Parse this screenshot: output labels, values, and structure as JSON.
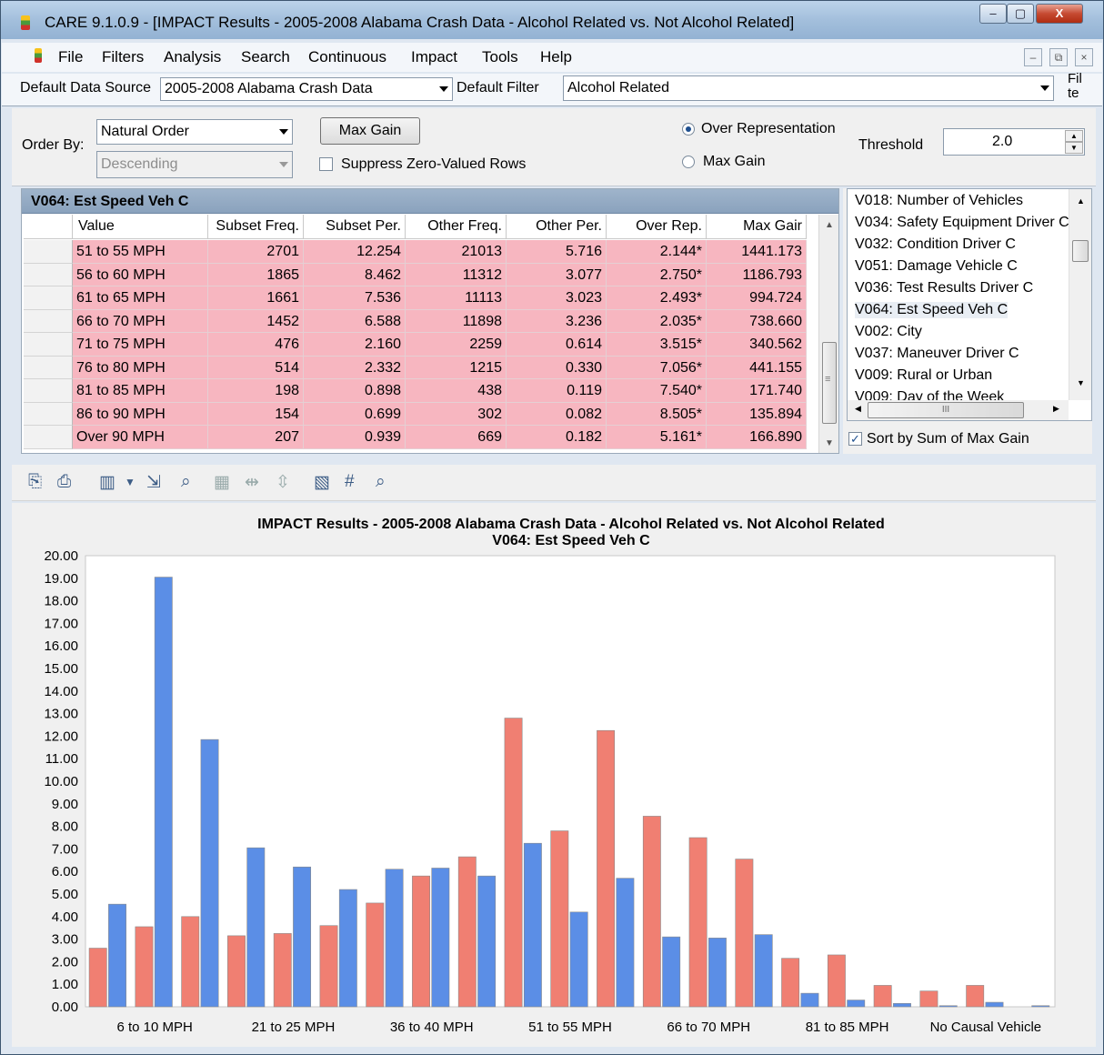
{
  "window": {
    "title": "CARE 9.1.0.9 - [IMPACT Results - 2005-2008 Alabama Crash Data - Alcohol Related vs. Not Alcohol Related]",
    "controls": {
      "minimize": "–",
      "maximize": "▢",
      "close": "X"
    }
  },
  "menu": {
    "items": [
      "File",
      "Filters",
      "Analysis",
      "Search",
      "Continuous",
      "Impact",
      "Tools",
      "Help"
    ],
    "mdi": {
      "minimize": "–",
      "restore": "⧉",
      "close": "×"
    }
  },
  "source_bar": {
    "data_source_label": "Default Data Source",
    "data_source_value": "2005-2008 Alabama Crash Data",
    "filter_label": "Default Filter",
    "filter_value": "Alcohol Related",
    "fil_button": "Fil te"
  },
  "options": {
    "order_by_label": "Order By:",
    "order_value": "Natural Order",
    "direction_value": "Descending",
    "max_gain_button": "Max Gain",
    "suppress_label": "Suppress Zero-Valued Rows",
    "suppress_checked": false,
    "radio_over_rep": "Over Representation",
    "radio_max_gain": "Max Gain",
    "selected_radio": "Over Representation",
    "threshold_label": "Threshold",
    "threshold_value": "2.0"
  },
  "grid": {
    "title": "V064: Est Speed Veh C",
    "columns": [
      "Value",
      "Subset Freq.",
      "Subset Per.",
      "Other Freq.",
      "Other Per.",
      "Over Rep.",
      "Max Gair"
    ],
    "rows": [
      [
        "51 to 55 MPH",
        "2701",
        "12.254",
        "21013",
        "5.716",
        "2.144*",
        "1441.173"
      ],
      [
        "56 to 60 MPH",
        "1865",
        "8.462",
        "11312",
        "3.077",
        "2.750*",
        "1186.793"
      ],
      [
        "61 to 65 MPH",
        "1661",
        "7.536",
        "11113",
        "3.023",
        "2.493*",
        "994.724"
      ],
      [
        "66 to 70 MPH",
        "1452",
        "6.588",
        "11898",
        "3.236",
        "2.035*",
        "738.660"
      ],
      [
        "71 to 75 MPH",
        "476",
        "2.160",
        "2259",
        "0.614",
        "3.515*",
        "340.562"
      ],
      [
        "76 to 80 MPH",
        "514",
        "2.332",
        "1215",
        "0.330",
        "7.056*",
        "441.155"
      ],
      [
        "81 to 85 MPH",
        "198",
        "0.898",
        "438",
        "0.119",
        "7.540*",
        "171.740"
      ],
      [
        "86 to 90 MPH",
        "154",
        "0.699",
        "302",
        "0.082",
        "8.505*",
        "135.894"
      ],
      [
        "Over 90 MPH",
        "207",
        "0.939",
        "669",
        "0.182",
        "5.161*",
        "166.890"
      ]
    ]
  },
  "variable_list": {
    "items": [
      "V018: Number of Vehicles",
      "V034: Safety Equipment Driver C",
      "V032: Condition Driver C",
      "V051: Damage Vehicle C",
      "V036: Test Results Driver C",
      "V064: Est Speed Veh C",
      "V002: City",
      "V037: Maneuver Driver C",
      "V009: Rural or Urban",
      "V009: Day of the Week"
    ],
    "selected_index": 5,
    "hscroll_grip": "III",
    "sort_label": "Sort by Sum of Max Gain",
    "sort_checked": true
  },
  "toolbar": {
    "icons": [
      "copy-icon",
      "print-icon",
      "chart-type-icon",
      "dropdown-arrow-icon",
      "export-icon",
      "zoom-in-icon",
      "grid-icon",
      "chevron-left-right-icon",
      "chevron-up-down-icon",
      "chart-options-icon",
      "data-labels-icon",
      "zoom-icon"
    ]
  },
  "chart_data": {
    "type": "bar",
    "title": "IMPACT Results - 2005-2008 Alabama Crash Data - Alcohol Related vs. Not Alcohol Related",
    "subtitle": "V064: Est Speed Veh C",
    "ylim": [
      0,
      20
    ],
    "ytick_step": 1,
    "categories": [
      "",
      "6 to 10 MPH",
      "",
      "21 to 25 MPH",
      "",
      "36 to 40 MPH",
      "",
      "51 to 55 MPH",
      "",
      "66 to 70 MPH",
      "",
      "81 to 85 MPH",
      "",
      "No Causal Vehicle"
    ],
    "group_count": 21,
    "xlabel_groups": [
      2,
      5,
      8,
      11,
      14,
      17,
      20
    ],
    "xlabels": [
      "6 to 10 MPH",
      "21 to 25 MPH",
      "36 to 40 MPH",
      "51 to 55 MPH",
      "66 to 70 MPH",
      "81 to 85 MPH",
      "No Causal Vehicle"
    ],
    "series": [
      {
        "color": "#f07f72",
        "values": [
          2.6,
          3.55,
          4.0,
          3.15,
          3.25,
          3.6,
          4.6,
          5.8,
          6.65,
          12.8,
          7.8,
          12.25,
          8.45,
          7.5,
          6.55,
          2.15,
          2.3,
          0.95,
          0.7,
          0.95,
          0.0
        ]
      },
      {
        "color": "#5b8ee6",
        "values": [
          4.55,
          19.05,
          11.85,
          7.05,
          6.2,
          5.2,
          6.1,
          6.15,
          5.8,
          7.25,
          4.2,
          5.7,
          3.1,
          3.05,
          3.2,
          0.6,
          0.3,
          0.15,
          0.05,
          0.2,
          0.05
        ]
      }
    ],
    "grid": false,
    "legend": "none"
  }
}
